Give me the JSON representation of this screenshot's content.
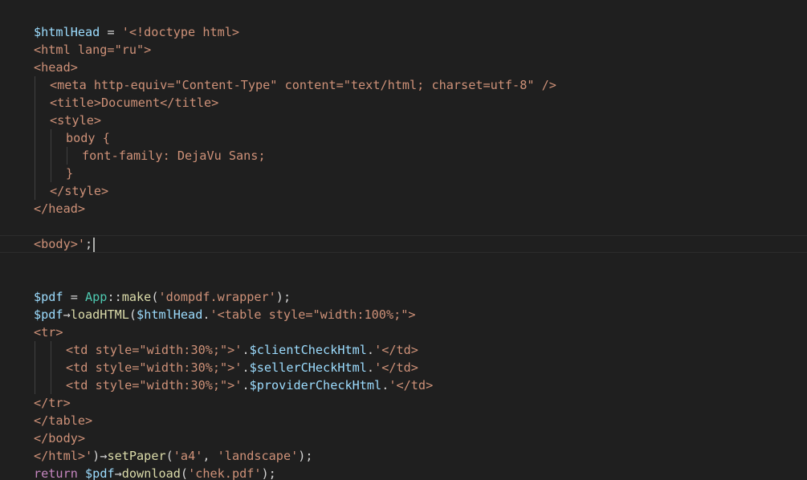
{
  "theme": {
    "background": "#1f1f1f",
    "variable": "#9cdcfe",
    "string": "#ce9178",
    "keyword": "#c586c0",
    "class": "#4ec9b0",
    "function": "#dcdcaa",
    "operator": "#d4d4d4",
    "plain": "#cccccc"
  },
  "editor": {
    "cursor_line": 13,
    "lines": [
      {
        "indent": 0,
        "tokens": [
          {
            "t": "$htmlHead",
            "c": "variable"
          },
          {
            "t": " = ",
            "c": "operator"
          },
          {
            "t": "'<!doctype html>",
            "c": "string"
          }
        ]
      },
      {
        "indent": 0,
        "tokens": [
          {
            "t": "<html lang=\"ru\">",
            "c": "string"
          }
        ]
      },
      {
        "indent": 0,
        "tokens": [
          {
            "t": "<head>",
            "c": "string"
          }
        ]
      },
      {
        "indent": 1,
        "tokens": [
          {
            "t": "<meta http-equiv=\"Content-Type\" content=\"text/html; charset=utf-8\" />",
            "c": "string"
          }
        ]
      },
      {
        "indent": 1,
        "tokens": [
          {
            "t": "<title>Document</title>",
            "c": "string"
          }
        ]
      },
      {
        "indent": 1,
        "tokens": [
          {
            "t": "<style>",
            "c": "string"
          }
        ]
      },
      {
        "indent": 2,
        "tokens": [
          {
            "t": "body {",
            "c": "string"
          }
        ]
      },
      {
        "indent": 3,
        "tokens": [
          {
            "t": "font-family: DejaVu Sans;",
            "c": "string"
          }
        ]
      },
      {
        "indent": 2,
        "tokens": [
          {
            "t": "}",
            "c": "string"
          }
        ]
      },
      {
        "indent": 1,
        "tokens": [
          {
            "t": "</style>",
            "c": "string"
          }
        ]
      },
      {
        "indent": 0,
        "tokens": [
          {
            "t": "</head>",
            "c": "string"
          }
        ]
      },
      {
        "indent": 0,
        "tokens": []
      },
      {
        "indent": 0,
        "tokens": [
          {
            "t": "<body>'",
            "c": "string"
          },
          {
            "t": ";",
            "c": "operator"
          }
        ]
      },
      {
        "indent": 0,
        "tokens": []
      },
      {
        "indent": 0,
        "tokens": []
      },
      {
        "indent": 0,
        "tokens": [
          {
            "t": "$pdf",
            "c": "variable"
          },
          {
            "t": " = ",
            "c": "operator"
          },
          {
            "t": "App",
            "c": "class"
          },
          {
            "t": "::",
            "c": "operator"
          },
          {
            "t": "make",
            "c": "function"
          },
          {
            "t": "(",
            "c": "operator"
          },
          {
            "t": "'dompdf.wrapper'",
            "c": "string"
          },
          {
            "t": ");",
            "c": "operator"
          }
        ]
      },
      {
        "indent": 0,
        "tokens": [
          {
            "t": "$pdf",
            "c": "variable"
          },
          {
            "t": "→",
            "c": "operator"
          },
          {
            "t": "loadHTML",
            "c": "function"
          },
          {
            "t": "(",
            "c": "operator"
          },
          {
            "t": "$htmlHead",
            "c": "variable"
          },
          {
            "t": ".",
            "c": "operator"
          },
          {
            "t": "'<table style=\"width:100%;\">",
            "c": "string"
          }
        ]
      },
      {
        "indent": 0,
        "tokens": [
          {
            "t": "<tr>",
            "c": "string"
          }
        ]
      },
      {
        "indent": 2,
        "tokens": [
          {
            "t": "<td style=\"width:30%;\">'",
            "c": "string"
          },
          {
            "t": ".",
            "c": "operator"
          },
          {
            "t": "$clientCheckHtml",
            "c": "variable"
          },
          {
            "t": ".",
            "c": "operator"
          },
          {
            "t": "'</td>",
            "c": "string"
          }
        ]
      },
      {
        "indent": 2,
        "tokens": [
          {
            "t": "<td style=\"width:30%;\">'",
            "c": "string"
          },
          {
            "t": ".",
            "c": "operator"
          },
          {
            "t": "$sellerCHeckHtml",
            "c": "variable"
          },
          {
            "t": ".",
            "c": "operator"
          },
          {
            "t": "'</td>",
            "c": "string"
          }
        ]
      },
      {
        "indent": 2,
        "tokens": [
          {
            "t": "<td style=\"width:30%;\">'",
            "c": "string"
          },
          {
            "t": ".",
            "c": "operator"
          },
          {
            "t": "$providerCheckHtml",
            "c": "variable"
          },
          {
            "t": ".",
            "c": "operator"
          },
          {
            "t": "'</td>",
            "c": "string"
          }
        ]
      },
      {
        "indent": 0,
        "tokens": [
          {
            "t": "</tr>",
            "c": "string"
          }
        ]
      },
      {
        "indent": 0,
        "tokens": [
          {
            "t": "</table>",
            "c": "string"
          }
        ]
      },
      {
        "indent": 0,
        "tokens": [
          {
            "t": "</body>",
            "c": "string"
          }
        ]
      },
      {
        "indent": 0,
        "tokens": [
          {
            "t": "</html>'",
            "c": "string"
          },
          {
            "t": ")",
            "c": "operator"
          },
          {
            "t": "→",
            "c": "operator"
          },
          {
            "t": "setPaper",
            "c": "function"
          },
          {
            "t": "(",
            "c": "operator"
          },
          {
            "t": "'a4'",
            "c": "string"
          },
          {
            "t": ", ",
            "c": "operator"
          },
          {
            "t": "'landscape'",
            "c": "string"
          },
          {
            "t": ");",
            "c": "operator"
          }
        ]
      },
      {
        "indent": 0,
        "tokens": [
          {
            "t": "return",
            "c": "keyword"
          },
          {
            "t": " ",
            "c": "operator"
          },
          {
            "t": "$pdf",
            "c": "variable"
          },
          {
            "t": "→",
            "c": "operator"
          },
          {
            "t": "download",
            "c": "function"
          },
          {
            "t": "(",
            "c": "operator"
          },
          {
            "t": "'chek.pdf'",
            "c": "string"
          },
          {
            "t": ");",
            "c": "operator"
          }
        ]
      }
    ]
  }
}
